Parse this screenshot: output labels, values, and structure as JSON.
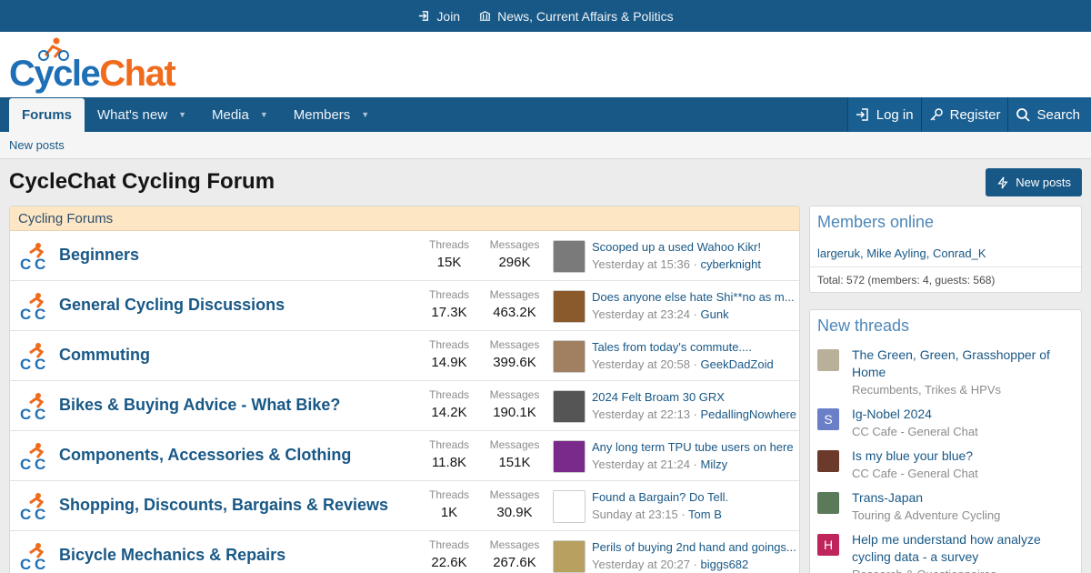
{
  "topbar": {
    "join": "Join",
    "news": "News, Current Affairs & Politics"
  },
  "logo": {
    "part1": "Cycle",
    "part2": "Chat"
  },
  "nav": {
    "tabs": [
      {
        "label": "Forums"
      },
      {
        "label": "What's new"
      },
      {
        "label": "Media"
      },
      {
        "label": "Members"
      }
    ],
    "login": "Log in",
    "register": "Register",
    "search": "Search"
  },
  "subnav": {
    "new_posts": "New posts"
  },
  "page": {
    "title": "CycleChat Cycling Forum",
    "new_posts_button": "New posts"
  },
  "forums": {
    "heading": "Cycling Forums",
    "threads_label": "Threads",
    "messages_label": "Messages",
    "nodes": [
      {
        "title": "Beginners",
        "threads": "15K",
        "messages": "296K",
        "latest": "Scooped up a used Wahoo Kikr!",
        "when": "Yesterday at 15:36",
        "user": "cyberknight",
        "thumb_color": "#7a7a7a"
      },
      {
        "title": "General Cycling Discussions",
        "threads": "17.3K",
        "messages": "463.2K",
        "latest": "Does anyone else hate Shi**no as m...",
        "when": "Yesterday at 23:24",
        "user": "Gunk",
        "thumb_color": "#8a5a2b"
      },
      {
        "title": "Commuting",
        "threads": "14.9K",
        "messages": "399.6K",
        "latest": "Tales from today's commute....",
        "when": "Yesterday at 20:58",
        "user": "GeekDadZoid",
        "thumb_color": "#a08060"
      },
      {
        "title": "Bikes & Buying Advice - What Bike?",
        "threads": "14.2K",
        "messages": "190.1K",
        "latest": "2024 Felt Broam 30 GRX",
        "when": "Yesterday at 22:13",
        "user": "PedallingNowhere",
        "thumb_color": "#555555"
      },
      {
        "title": "Components, Accessories & Clothing",
        "threads": "11.8K",
        "messages": "151K",
        "latest": "Any long term TPU tube users on here",
        "when": "Yesterday at 21:24",
        "user": "Milzy",
        "thumb_color": "#7a2a8a"
      },
      {
        "title": "Shopping, Discounts, Bargains & Reviews",
        "threads": "1K",
        "messages": "30.9K",
        "latest": "Found a Bargain? Do Tell.",
        "when": "Sunday at 23:15",
        "user": "Tom B",
        "thumb_color": "#ffffff"
      },
      {
        "title": "Bicycle Mechanics & Repairs",
        "threads": "22.6K",
        "messages": "267.6K",
        "latest": "Perils of buying 2nd hand and goings...",
        "when": "Yesterday at 20:27",
        "user": "biggs682",
        "thumb_color": "#b8a060"
      }
    ]
  },
  "members_online": {
    "title": "Members online",
    "users": [
      "largeruk",
      "Mike Ayling",
      "Conrad_K"
    ],
    "total": "Total: 572 (members: 4, guests: 568)"
  },
  "new_threads": {
    "title": "New threads",
    "items": [
      {
        "title": "The Green, Green, Grasshopper of Home",
        "forum": "Recumbents, Trikes & HPVs",
        "avatar": "",
        "color": "#b8b098"
      },
      {
        "title": "Ig-Nobel 2024",
        "forum": "CC Cafe - General Chat",
        "avatar": "S",
        "color": "#6a7fc8"
      },
      {
        "title": "Is my blue your blue?",
        "forum": "CC Cafe - General Chat",
        "avatar": "",
        "color": "#6b3a2a"
      },
      {
        "title": "Trans-Japan",
        "forum": "Touring & Adventure Cycling",
        "avatar": "",
        "color": "#5a7a5a"
      },
      {
        "title": "Help me understand how analyze cycling data - a survey",
        "forum": "Research & Questionnaires",
        "avatar": "H",
        "color": "#c0245c"
      }
    ]
  }
}
